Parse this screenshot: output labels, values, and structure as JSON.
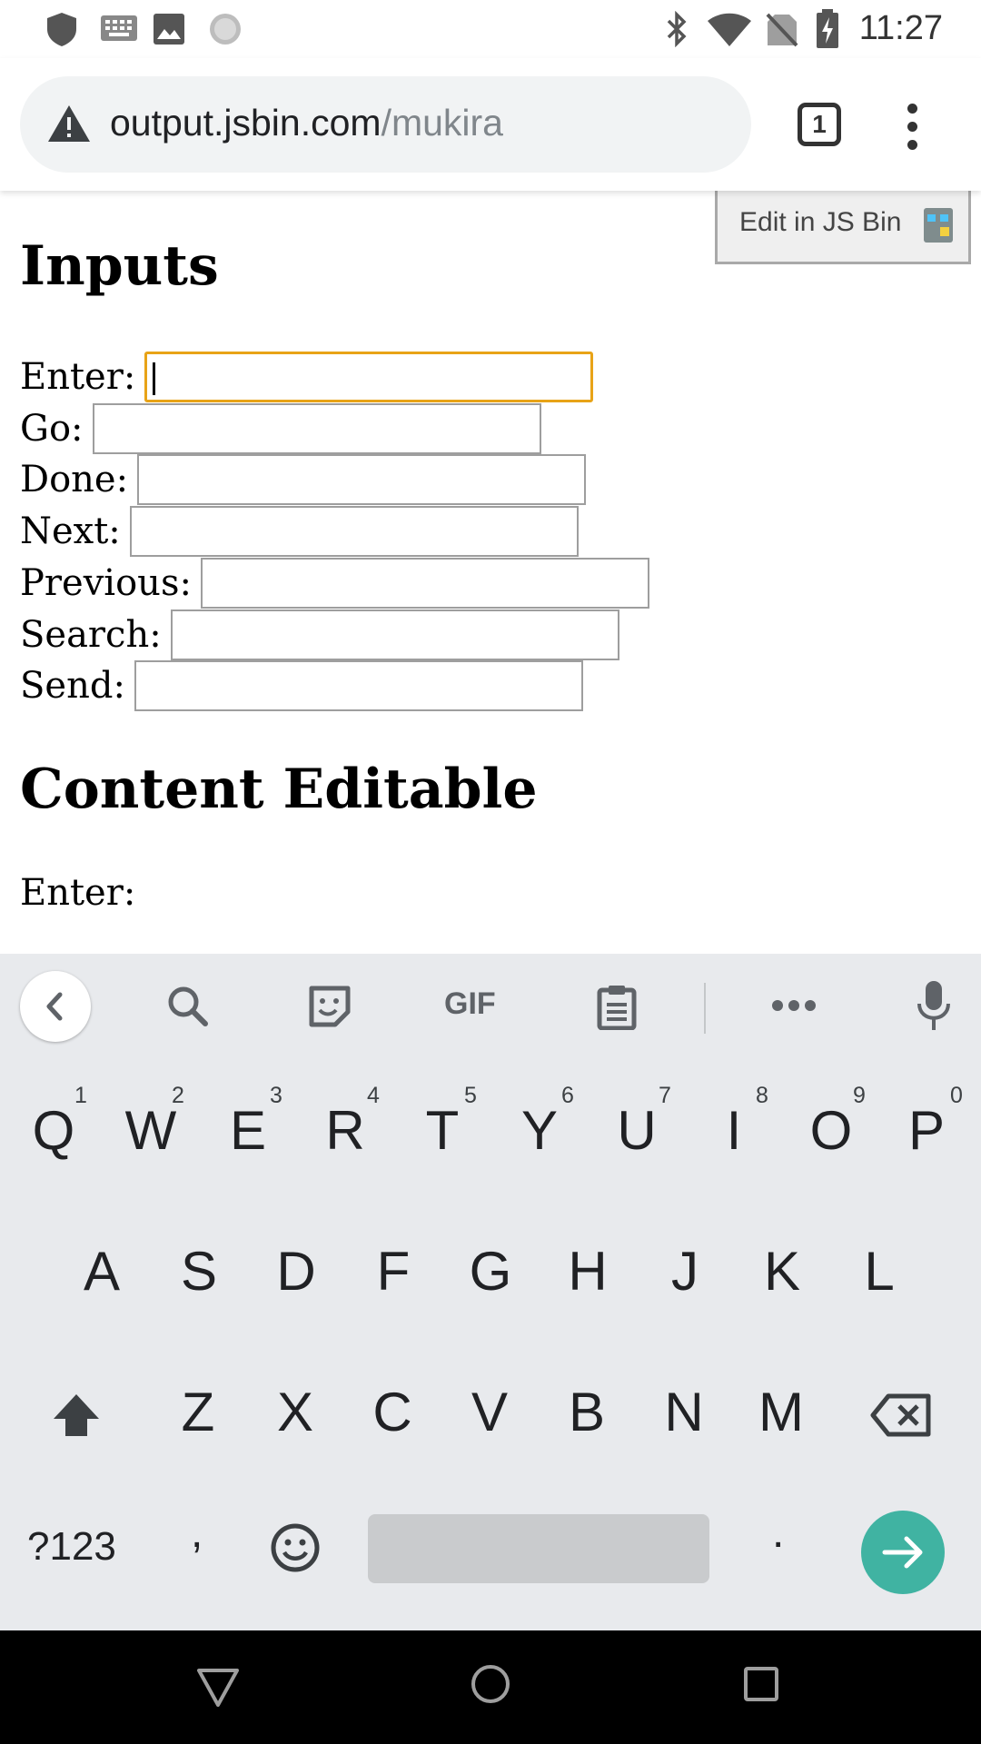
{
  "status_bar": {
    "time": "11:27",
    "left_icons": [
      "shield-icon",
      "keyboard-icon",
      "image-icon",
      "sync-icon"
    ],
    "right_icons": [
      "bluetooth-icon",
      "wifi-icon",
      "no-sim-icon",
      "battery-charging-icon"
    ]
  },
  "browser": {
    "url_host": "output.jsbin.com",
    "url_path": "/mukira",
    "tab_count": "1",
    "icons": [
      "warning-icon",
      "tabs-icon",
      "more-menu-icon"
    ]
  },
  "page": {
    "edit_button_label": "Edit in JS Bin",
    "heading_inputs": "Inputs",
    "inputs": [
      {
        "label": "Enter:",
        "value": ""
      },
      {
        "label": "Go:",
        "value": ""
      },
      {
        "label": "Done:",
        "value": ""
      },
      {
        "label": "Next:",
        "value": ""
      },
      {
        "label": "Previous:",
        "value": ""
      },
      {
        "label": "Search:",
        "value": ""
      },
      {
        "label": "Send:",
        "value": ""
      }
    ],
    "heading_content_editable": "Content Editable",
    "content_editable_label": "Enter:"
  },
  "keyboard": {
    "toolbar": [
      "back-icon",
      "search-icon",
      "sticker-icon",
      "gif-icon",
      "clipboard-icon",
      "more-icon",
      "mic-icon"
    ],
    "gif_label": "GIF",
    "row1": [
      "Q",
      "W",
      "E",
      "R",
      "T",
      "Y",
      "U",
      "I",
      "O",
      "P"
    ],
    "row1_hints": [
      "1",
      "2",
      "3",
      "4",
      "5",
      "6",
      "7",
      "8",
      "9",
      "0"
    ],
    "row2": [
      "A",
      "S",
      "D",
      "F",
      "G",
      "H",
      "J",
      "K",
      "L"
    ],
    "row3": [
      "Z",
      "X",
      "C",
      "V",
      "B",
      "N",
      "M"
    ],
    "symbols_label": "?123",
    "comma": ",",
    "period": ".",
    "accent_color": "#40b3a2"
  },
  "nav_bar": {
    "icons": [
      "back-triangle-icon",
      "home-circle-icon",
      "recents-square-icon"
    ]
  }
}
